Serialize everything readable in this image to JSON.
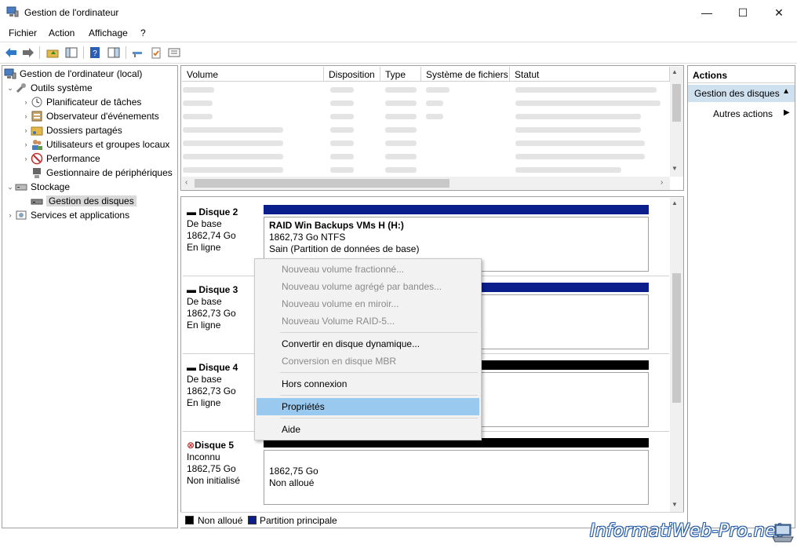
{
  "window": {
    "title": "Gestion de l'ordinateur",
    "min_glyph": "—",
    "max_glyph": "☐",
    "close_glyph": "✕"
  },
  "menu": [
    "Fichier",
    "Action",
    "Affichage",
    "?"
  ],
  "toolbar_icons": [
    "back-arrow-icon",
    "forward-arrow-icon",
    "up-folder-icon",
    "show-hide-tree-icon",
    "help-icon",
    "properties-panel-icon",
    "connect-icon",
    "checklist-icon",
    "list-view-icon"
  ],
  "tree": {
    "root": "Gestion de l'ordinateur (local)",
    "system_tools": "Outils système",
    "task_scheduler": "Planificateur de tâches",
    "event_viewer": "Observateur d'événements",
    "shared_folders": "Dossiers partagés",
    "local_users": "Utilisateurs et groupes locaux",
    "performance": "Performance",
    "device_manager": "Gestionnaire de périphériques",
    "storage": "Stockage",
    "disk_management": "Gestion des disques",
    "services": "Services et applications"
  },
  "volume_list": {
    "columns": [
      "Volume",
      "Disposition",
      "Type",
      "Système de fichiers",
      "Statut"
    ]
  },
  "disks": [
    {
      "name": "Disque 2",
      "type": "De base",
      "size": "1862,74 Go",
      "status": "En ligne",
      "bar_color": "#0a1e8c",
      "partition": {
        "label": "RAID Win Backups VMs H  (H:)",
        "line1": "1862,73 Go NTFS",
        "line2": "Sain (Partition de données de base)"
      }
    },
    {
      "name": "Disque 3",
      "type": "De base",
      "size": "1862,73 Go",
      "status": "En ligne",
      "bar_color": "#0a1e8c"
    },
    {
      "name": "Disque 4",
      "type": "De base",
      "size": "1862,73 Go",
      "status": "En ligne",
      "bar_color": "#000000"
    },
    {
      "name": "Disque 5",
      "type": "Inconnu",
      "size": "1862,75 Go",
      "status": "Non initialisé",
      "bar_color": "#000000",
      "partition": {
        "line1": "1862,75 Go",
        "line2": "Non alloué"
      }
    }
  ],
  "legend": [
    {
      "label": "Non alloué",
      "color": "#000000"
    },
    {
      "label": "Partition principale",
      "color": "#0a1e8c"
    }
  ],
  "actions": {
    "header": "Actions",
    "selected": "Gestion des disques",
    "other": "Autres actions"
  },
  "context_menu": {
    "new_spanned": "Nouveau volume fractionné...",
    "new_striped": "Nouveau volume agrégé par bandes...",
    "new_mirror": "Nouveau volume en miroir...",
    "new_raid5": "Nouveau Volume RAID-5...",
    "convert_dynamic": "Convertir en disque dynamique...",
    "convert_mbr": "Conversion en disque MBR",
    "offline": "Hors connexion",
    "properties": "Propriétés",
    "help": "Aide"
  },
  "watermark": "InformatiWeb-Pro.net"
}
